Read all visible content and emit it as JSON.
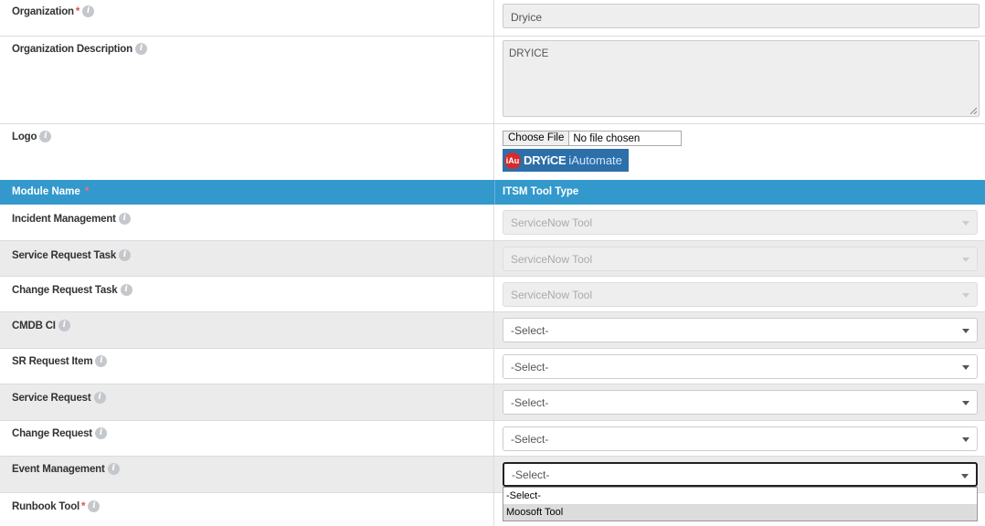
{
  "organization": {
    "label": "Organization",
    "required_mark": "*",
    "value": "Dryice"
  },
  "description": {
    "label": "Organization Description",
    "value": "DRYICE"
  },
  "logo": {
    "label": "Logo",
    "choose_file": "Choose File",
    "file_status": "No file chosen",
    "image": {
      "badge_text": "iAu",
      "brand": "DRYiCE",
      "product": "iAutomate"
    }
  },
  "table_header": {
    "module_name": "Module Name",
    "required_mark": "*",
    "itsm_tool_type": "ITSM Tool Type"
  },
  "modules": [
    {
      "label": "Incident Management",
      "value": "ServiceNow Tool",
      "disabled": true
    },
    {
      "label": "Service Request Task",
      "value": "ServiceNow Tool",
      "disabled": true
    },
    {
      "label": "Change Request Task",
      "value": "ServiceNow Tool",
      "disabled": true
    },
    {
      "label": "CMDB CI",
      "value": "-Select-",
      "disabled": false
    },
    {
      "label": "SR Request Item",
      "value": "-Select-",
      "disabled": false
    },
    {
      "label": "Service Request",
      "value": "-Select-",
      "disabled": false
    },
    {
      "label": "Change Request",
      "value": "-Select-",
      "disabled": false
    },
    {
      "label": "Event Management",
      "value": "-Select-",
      "disabled": false,
      "focused": true
    }
  ],
  "runbook": {
    "label": "Runbook Tool",
    "required_mark": "*"
  },
  "event_dropdown_options": [
    {
      "label": "-Select-",
      "highlighted": false
    },
    {
      "label": "Moosoft Tool",
      "highlighted": true
    }
  ],
  "colors": {
    "header_bg": "#3399cc",
    "alt_row_bg": "#ebebeb",
    "required": "#d9534f"
  },
  "icons": {
    "info": "info-icon",
    "select_caret": "caret-down-icon"
  }
}
